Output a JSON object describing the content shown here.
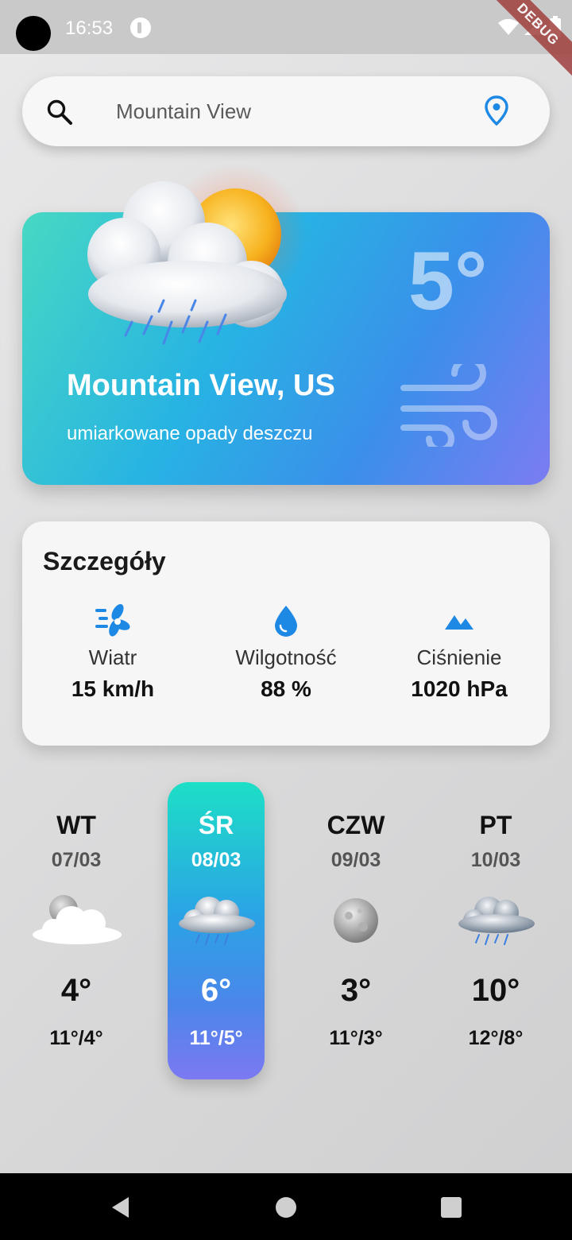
{
  "status_bar": {
    "time": "16:53",
    "debug_label": "DEBUG"
  },
  "search": {
    "value": "Mountain View",
    "placeholder": ""
  },
  "current": {
    "temp": "5°",
    "city": "Mountain View, US",
    "description": "umiarkowane opady deszczu",
    "icon": "sun-cloud-rain-icon"
  },
  "details": {
    "title": "Szczegóły",
    "items": [
      {
        "label": "Wiatr",
        "value": "15 km/h",
        "icon": "wind-turbine-icon"
      },
      {
        "label": "Wilgotność",
        "value": "88 %",
        "icon": "water-drop-icon"
      },
      {
        "label": "Ciśnienie",
        "value": "1020 hPa",
        "icon": "mountains-icon"
      }
    ]
  },
  "forecast": [
    {
      "day": "WT",
      "date": "07/03",
      "temp": "4°",
      "range": "11°/4°",
      "icon": "moon-cloud-icon",
      "selected": false
    },
    {
      "day": "ŚR",
      "date": "08/03",
      "temp": "6°",
      "range": "11°/5°",
      "icon": "cloud-rain-icon",
      "selected": true
    },
    {
      "day": "CZW",
      "date": "09/03",
      "temp": "3°",
      "range": "11°/3°",
      "icon": "moon-icon",
      "selected": false
    },
    {
      "day": "PT",
      "date": "10/03",
      "temp": "10°",
      "range": "12°/8°",
      "icon": "cloud-rain-icon",
      "selected": false
    }
  ],
  "colors": {
    "accent": "#1e88e5",
    "card_gradient_start": "#47d8c3",
    "card_gradient_end": "#7c7cf2"
  }
}
